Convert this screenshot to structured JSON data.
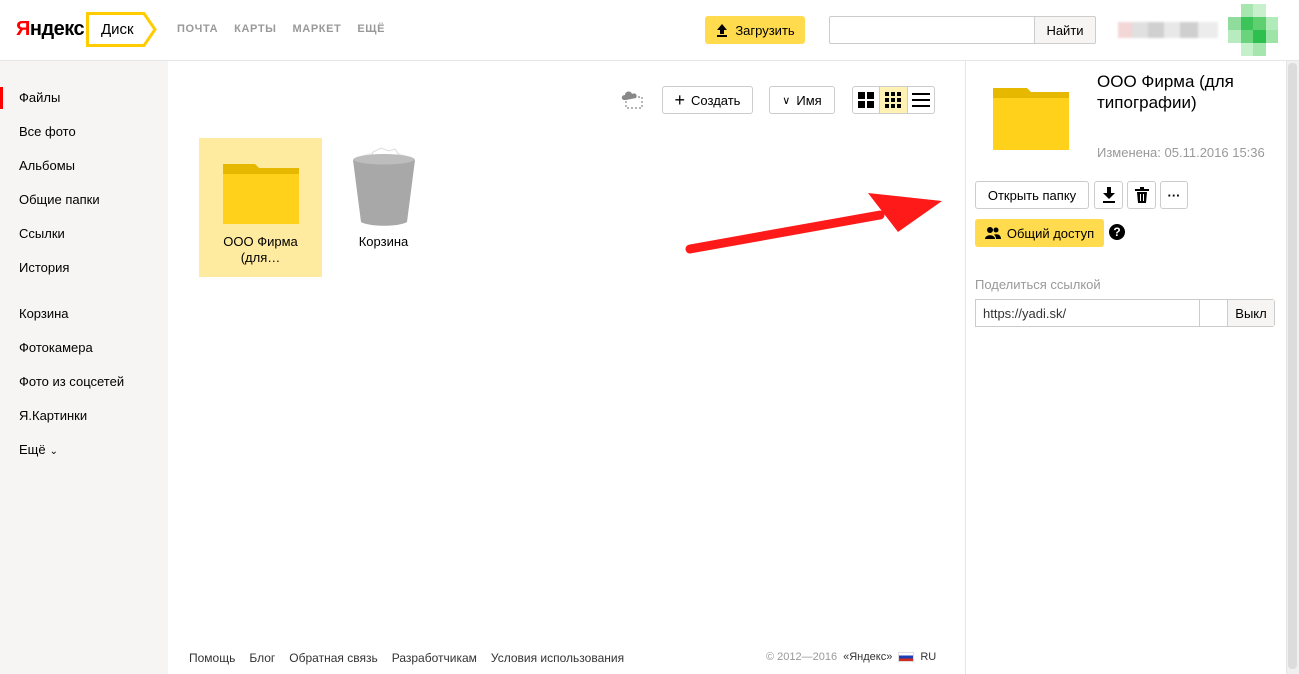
{
  "header": {
    "logo_r": "Я",
    "logo_rest": "ндекс",
    "service": "Диск",
    "nav": [
      "ПОЧТА",
      "КАРТЫ",
      "МАРКЕТ",
      "ЕЩЁ"
    ],
    "upload_label": "Загрузить",
    "search_value": "",
    "search_button": "Найти",
    "accent": "#ffdb4d"
  },
  "sidebar": {
    "items": [
      "Файлы",
      "Все фото",
      "Альбомы",
      "Общие папки",
      "Ссылки",
      "История"
    ],
    "items2": [
      "Корзина",
      "Фотокамера",
      "Фото из соцсетей",
      "Я.Картинки"
    ],
    "more_label": "Ещё",
    "active_color": "#ff0000"
  },
  "toolbar": {
    "create_label": "Создать",
    "sort_label": "Имя"
  },
  "files": [
    {
      "name": "ООО Фирма (для…",
      "type": "folder-icon",
      "selected": true
    },
    {
      "name": "Корзина",
      "type": "trash-icon",
      "selected": false
    }
  ],
  "footer": {
    "links": [
      "Помощь",
      "Блог",
      "Обратная связь",
      "Разработчикам",
      "Условия использования"
    ],
    "copyright": "© 2012—2016",
    "company": "«Яндекс»",
    "lang": "RU"
  },
  "panel": {
    "title": "ООО Фирма (для типографии)",
    "modified": "Изменена: 05.11.2016 15:36",
    "open_folder": "Открыть папку",
    "more": "···",
    "share_access": "Общий доступ",
    "help": "?",
    "share_link_label": "Поделиться ссылкой",
    "link_value": "https://yadi.sk/",
    "toggle_label": "Выкл"
  }
}
